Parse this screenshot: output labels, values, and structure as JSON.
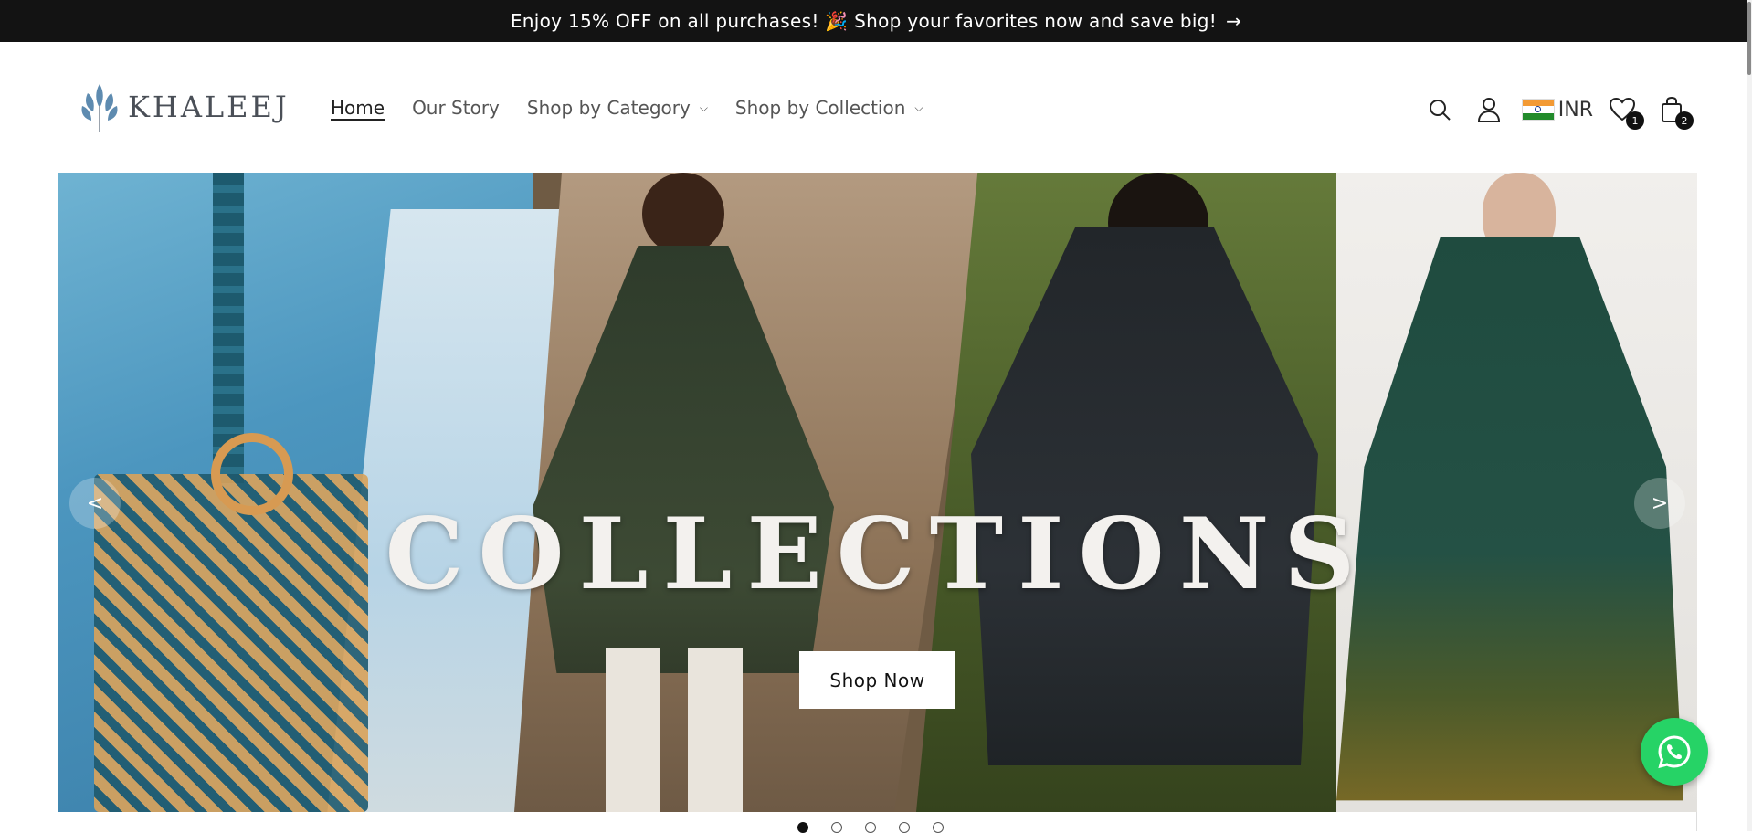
{
  "announcement": {
    "text": "Enjoy 15% OFF on all purchases! 🎉 Shop your favorites now and save big!",
    "arrow": "→"
  },
  "header": {
    "logo_text": "KHALEEJ",
    "nav": {
      "home": "Home",
      "our_story": "Our Story",
      "shop_by_category": "Shop by Category",
      "shop_by_collection": "Shop by Collection"
    },
    "currency": "INR",
    "wishlist_count": "1",
    "cart_count": "2",
    "icons": [
      "search-icon",
      "account-icon",
      "india-flag-icon",
      "heart-icon",
      "shopping-bag-icon"
    ]
  },
  "hero": {
    "title": "COLLECTIONS",
    "button_label": "Shop Now",
    "prev_label": "<",
    "next_label": ">",
    "slides_total": 5,
    "active_slide": 1
  },
  "colors": {
    "announcement_bg": "#131313",
    "whatsapp_green": "#26d366",
    "active_dot": "#111111"
  }
}
